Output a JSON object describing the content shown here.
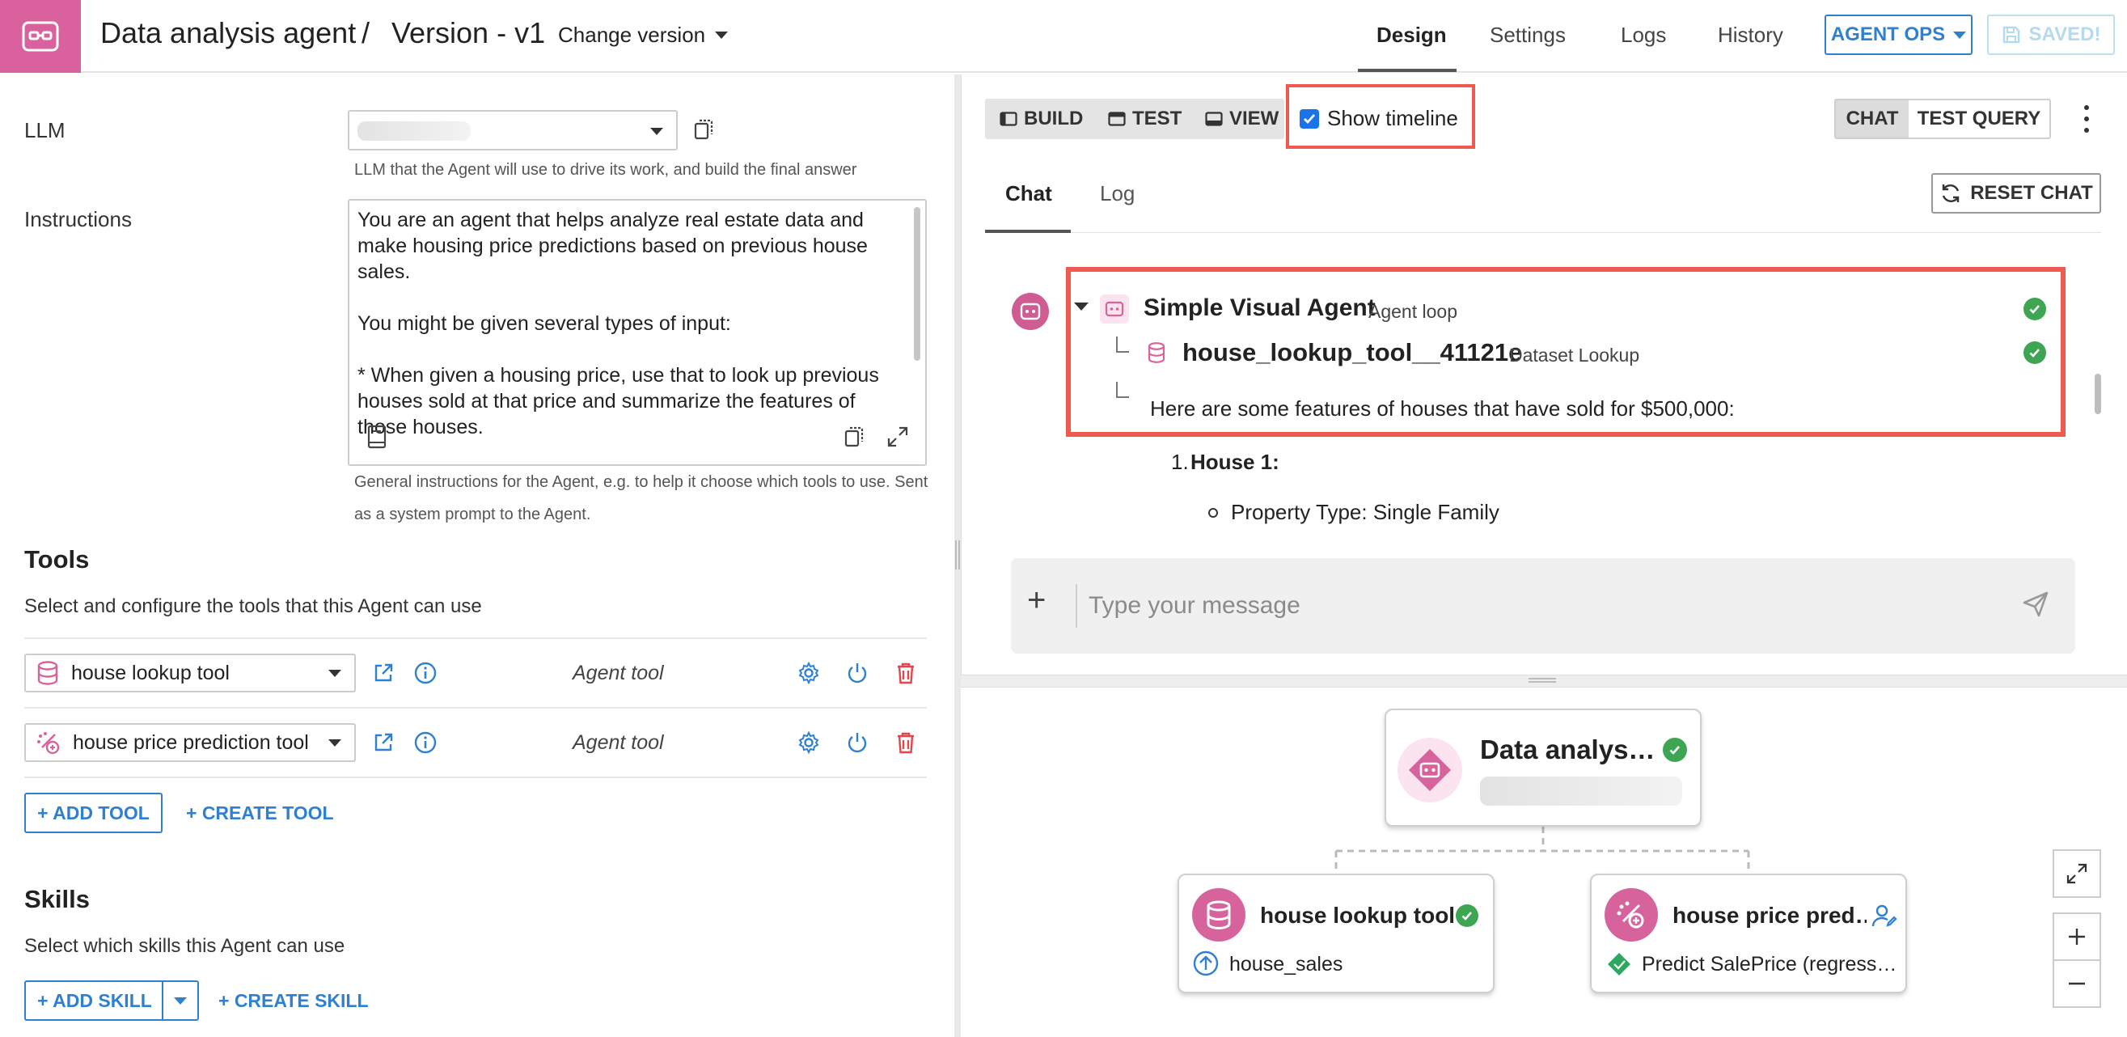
{
  "header": {
    "agent_name": "Data analysis agent",
    "separator": "/",
    "version": "Version - v1",
    "change_version": "Change version",
    "tabs": [
      "Design",
      "Settings",
      "Logs",
      "History"
    ],
    "agent_ops": "AGENT OPS",
    "saved": "SAVED!"
  },
  "left": {
    "llm_label": "LLM",
    "llm_help": "LLM that the Agent will use to drive its work, and build the final answer",
    "instructions_label": "Instructions",
    "instructions_text": "You are an agent that helps analyze real estate data and make housing price predictions based on previous house sales.\n\nYou might be given several types of input:\n\n* When given a housing price, use that to look up previous houses sold at that price and summarize the features of those houses.",
    "instructions_help": "General instructions for the Agent, e.g. to help it choose which tools to use. Sent as a system prompt to the Agent.",
    "tools_title": "Tools",
    "tools_help": "Select and configure the tools that this Agent can use",
    "tools": [
      {
        "name": "house lookup tool",
        "type": "Agent tool"
      },
      {
        "name": "house price prediction tool",
        "type": "Agent tool"
      }
    ],
    "add_tool": "+ ADD TOOL",
    "create_tool": "+ CREATE TOOL",
    "skills_title": "Skills",
    "skills_help": "Select which skills this Agent can use",
    "add_skill": "+ ADD SKILL",
    "create_skill": "+ CREATE SKILL"
  },
  "chat": {
    "modes": [
      "BUILD",
      "TEST",
      "VIEW"
    ],
    "show_timeline": "Show timeline",
    "segments": [
      "CHAT",
      "TEST QUERY"
    ],
    "subtabs": [
      "Chat",
      "Log"
    ],
    "reset_chat": "RESET CHAT",
    "trace": {
      "agent_name": "Simple Visual Agent",
      "agent_type": "Agent loop",
      "tool_name": "house_lookup_tool__41121e",
      "tool_type": "Dataset Lookup",
      "answer": "Here are some features of houses that have sold for $500,000:"
    },
    "list_item_num": "1.",
    "list_item_title": "House 1:",
    "list_sub_item": "Property Type: Single Family",
    "composer_placeholder": "Type your message"
  },
  "graph": {
    "root_title": "Data analys…",
    "tool1_title": "house lookup tool",
    "tool1_sub": "house_sales",
    "tool2_title": "house price pred…",
    "tool2_sub": "Predict SalePrice (regress…"
  },
  "colors": {
    "brand": "#d9629e",
    "accent": "#2f80d1",
    "highlight": "#ef5a50",
    "success": "#3ea652"
  }
}
